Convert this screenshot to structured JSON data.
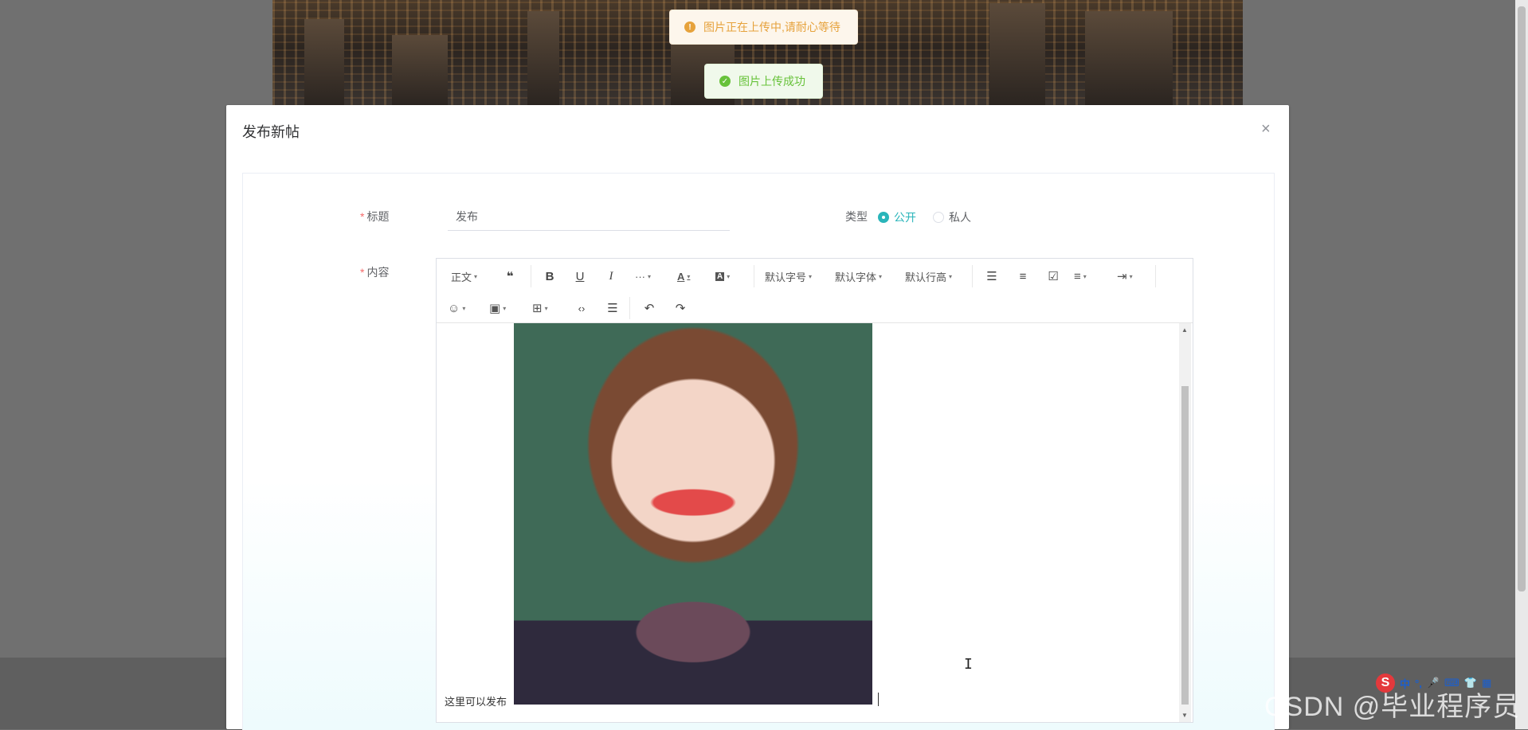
{
  "toasts": {
    "uploading": "图片正在上传中,请耐心等待",
    "success": "图片上传成功"
  },
  "dialog": {
    "title": "发布新帖",
    "close_glyph": "×"
  },
  "form": {
    "title_label": "标题",
    "title_value": "发布",
    "type_label": "类型",
    "type_options": [
      "公开",
      "私人"
    ],
    "type_selected": "公开",
    "content_label": "内容",
    "required_mark": "*"
  },
  "toolbar": {
    "row1": {
      "paragraph": "正文",
      "quote": "❝",
      "bold": "B",
      "underline": "U",
      "italic": "I",
      "more": "···",
      "font_color": "A",
      "bg_color": "A",
      "font_size": "默认字号",
      "font_family": "默认字体",
      "line_height": "默认行高",
      "bullet_list": "☰",
      "numbered_list": "≡",
      "todo": "☑",
      "align": "≡",
      "indent": "⇥"
    },
    "row2": {
      "emoji": "☺",
      "image": "▣",
      "table": "⊞",
      "code": "‹›",
      "divider": "☰",
      "undo": "↶",
      "redo": "↷"
    },
    "caret": "▾"
  },
  "editor": {
    "body_text": "这里可以发布"
  },
  "ime": {
    "logo": "S",
    "items": [
      "中",
      "°,",
      "🎤",
      "⌨",
      "👕",
      "▦"
    ]
  },
  "watermark": "CSDN @毕业程序员",
  "colors": {
    "accent": "#2ab5ba",
    "warning": "#e6a23c",
    "success": "#67c23a",
    "required": "#f56c6c"
  }
}
